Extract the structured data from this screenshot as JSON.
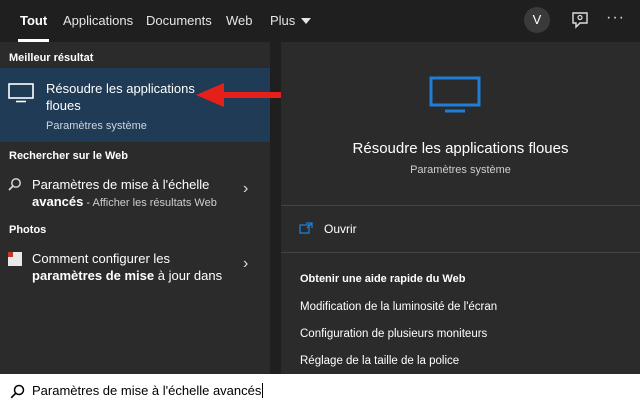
{
  "tabs": [
    "Tout",
    "Applications",
    "Documents",
    "Web",
    "Plus"
  ],
  "user_initial": "V",
  "more_label": "···",
  "sections": {
    "best": "Meilleur résultat",
    "web": "Rechercher sur le Web",
    "photos": "Photos"
  },
  "best_result": {
    "title_line1": "Résoudre les applications",
    "title_line2": "floues",
    "subtitle": "Paramètres système"
  },
  "web_result": {
    "line1": "Paramètres de mise à l'échelle",
    "line2_bold": "avancés",
    "line2_rest": " - Afficher les résultats Web"
  },
  "photo_result": {
    "line1a": "Comment configurer les",
    "line2_bold": "paramètres de mise",
    "line2_mid": " à ",
    "line2_rest": "jour dans"
  },
  "detail": {
    "title": "Résoudre les applications floues",
    "subtitle": "Paramètres système",
    "open": "Ouvrir",
    "help_heading": "Obtenir une aide rapide du Web",
    "links": [
      "Modification de la luminosité de l'écran",
      "Configuration de plusieurs moniteurs",
      "Réglage de la taille de la police"
    ]
  },
  "search": {
    "value": "Paramètres de mise à l'échelle avancés"
  },
  "colors": {
    "accent": "#1f7ed6",
    "selected_bg": "#203b55",
    "arrow": "#e5201b"
  }
}
